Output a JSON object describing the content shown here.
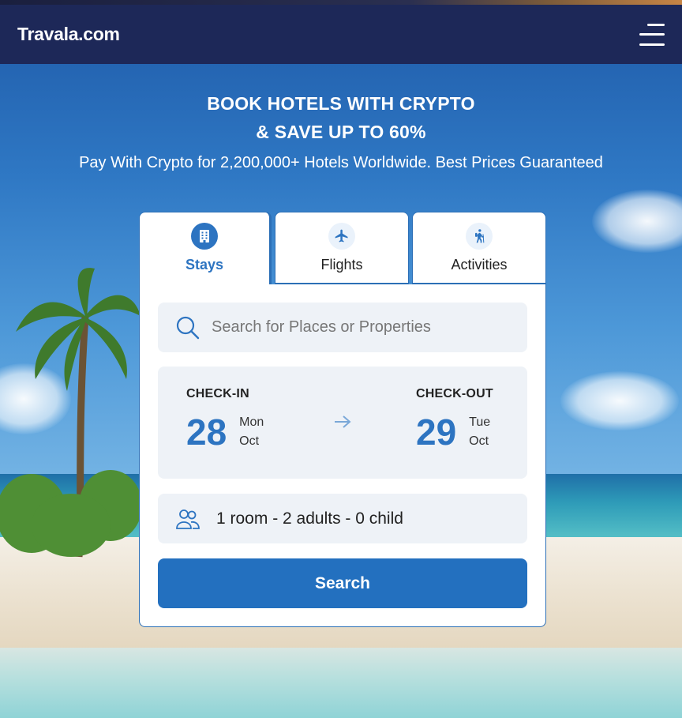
{
  "header": {
    "logo": "Travala.com",
    "menu_icon": "hamburger-menu-icon"
  },
  "hero": {
    "title_line1": "BOOK HOTELS WITH CRYPTO",
    "title_line2": "& SAVE UP TO 60%",
    "subtitle": "Pay With Crypto for 2,200,000+ Hotels Worldwide. Best Prices Guaranteed"
  },
  "tabs": [
    {
      "label": "Stays",
      "icon": "hotel-building-icon",
      "active": true
    },
    {
      "label": "Flights",
      "icon": "airplane-icon",
      "active": false
    },
    {
      "label": "Activities",
      "icon": "hiker-icon",
      "active": false
    }
  ],
  "search": {
    "placeholder": "Search for Places or Properties",
    "value": ""
  },
  "dates": {
    "checkin": {
      "title": "CHECK-IN",
      "day": "28",
      "weekday": "Mon",
      "month": "Oct"
    },
    "checkout": {
      "title": "CHECK-OUT",
      "day": "29",
      "weekday": "Tue",
      "month": "Oct"
    }
  },
  "guests": {
    "label": "1 room - 2 adults - 0 child"
  },
  "search_button": {
    "label": "Search"
  },
  "colors": {
    "brand_navy": "#1d2858",
    "accent_blue": "#2d74c1",
    "field_bg": "#eef2f7"
  }
}
